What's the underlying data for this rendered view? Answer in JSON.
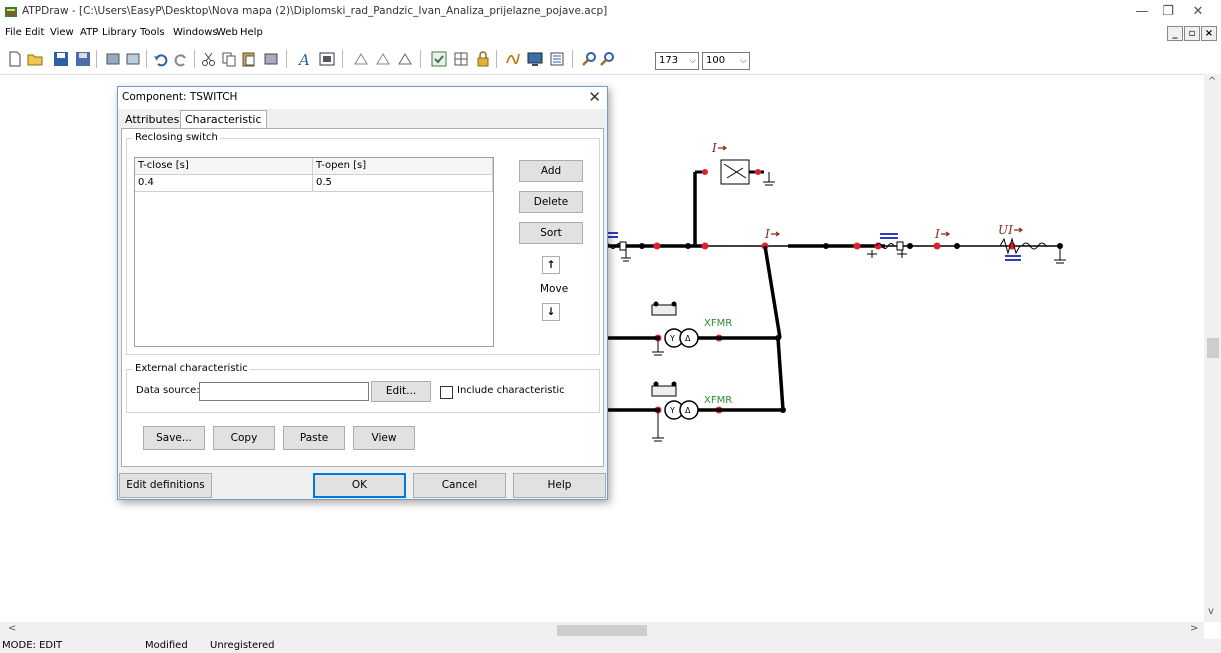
{
  "window": {
    "title": "ATPDraw - [C:\\Users\\EasyP\\Desktop\\Nova mapa (2)\\Diplomski_rad_Pandzic_Ivan_Analiza_prijelazne_pojave.acp]",
    "minimize": "—",
    "restore": "❐",
    "close": "✕"
  },
  "menu": {
    "items": [
      "File",
      "Edit",
      "View",
      "ATP",
      "Library",
      "Tools",
      "Windows",
      "Web",
      "Help"
    ],
    "mdi_min": "_",
    "mdi_restore": "▫",
    "mdi_close": "×"
  },
  "toolbar": {
    "zoom_value": "173",
    "zoom_step": "100"
  },
  "dialog": {
    "title": "Component: TSWITCH",
    "close": "✕",
    "tabs": [
      "Attributes",
      "Characteristic"
    ],
    "active_tab": "Characteristic",
    "reclosing_group_label": "Reclosing switch",
    "grid": {
      "columns": [
        "T-close [s]",
        "T-open [s]"
      ],
      "rows": [
        [
          "0.4",
          "0.5"
        ]
      ]
    },
    "buttons": {
      "add": "Add",
      "delete": "Delete",
      "sort": "Sort",
      "move_up": "↑",
      "move_label": "Move",
      "move_down": "↓"
    },
    "external": {
      "group_label": "External characteristic",
      "data_source_label": "Data source:",
      "data_source_value": "",
      "edit_button": "Edit...",
      "include_label": "Include characteristic",
      "include_checked": false
    },
    "actions": {
      "save": "Save...",
      "copy": "Copy",
      "paste": "Paste",
      "view": "View"
    },
    "footer": {
      "edit_definitions": "Edit definitions",
      "ok": "OK",
      "cancel": "Cancel",
      "help": "Help"
    }
  },
  "circuit": {
    "labels": {
      "current_probe": "I",
      "voltage_current_probe": "UI",
      "transformer_1": "XFMR",
      "transformer_2": "XFMR",
      "wye": "Y",
      "delta": "Δ"
    },
    "node_color": "#e0202a",
    "wire_color": "#000000",
    "probe_color": "#8b2a1a",
    "transformer_label_color": "#2e8b2e",
    "ground_accent_color": "#2a3fbf"
  },
  "scrollbars": {
    "left_arrow": "<",
    "right_arrow": ">",
    "up_arrow": "^",
    "down_arrow": "v"
  },
  "status": {
    "mode": "MODE: EDIT",
    "modified": "Modified",
    "registration": "Unregistered"
  }
}
